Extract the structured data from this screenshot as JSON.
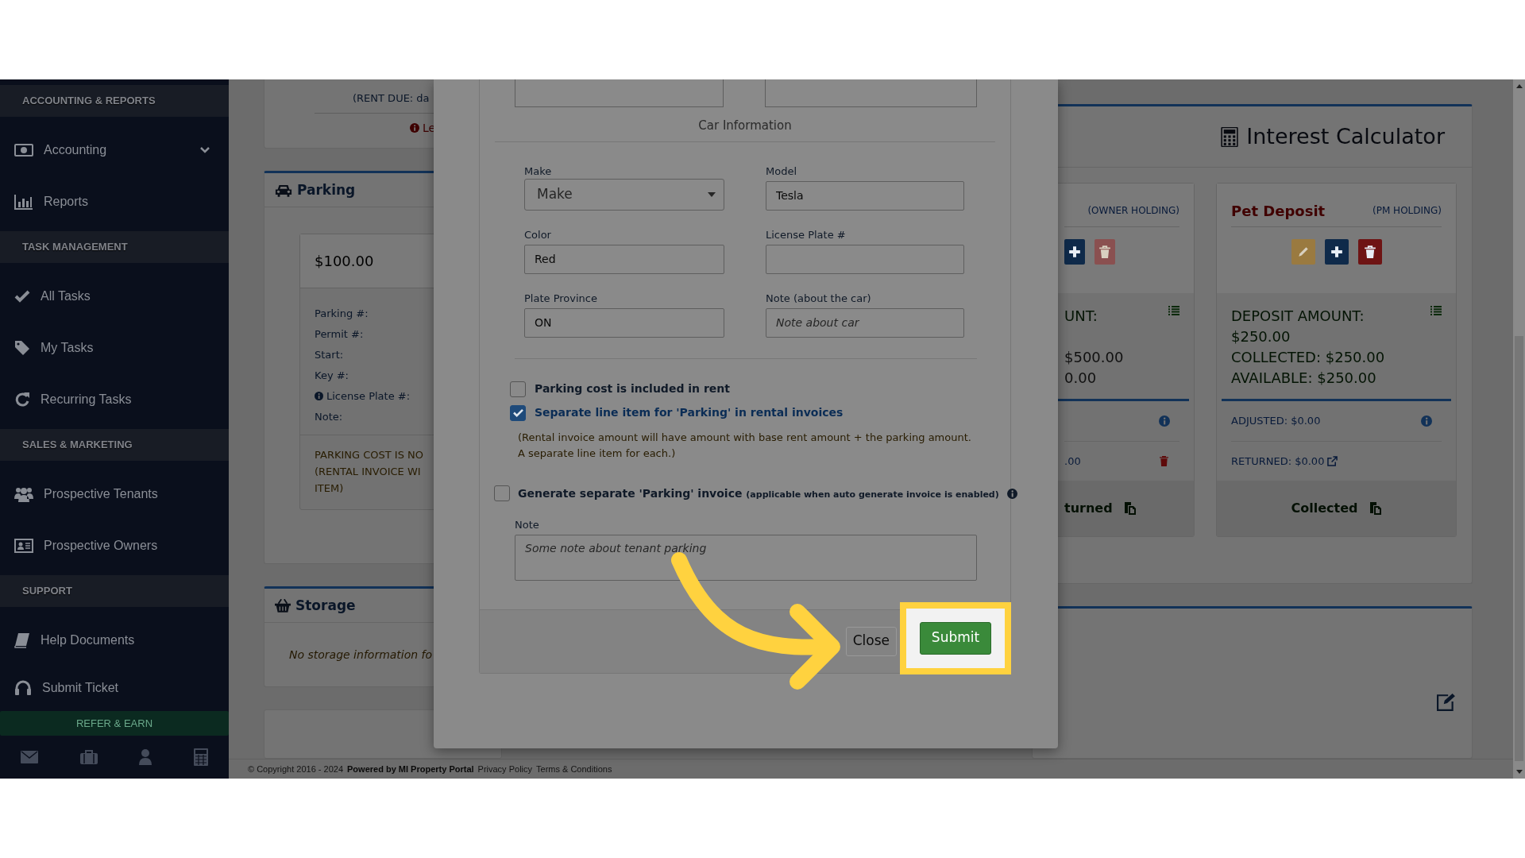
{
  "sidebar": {
    "sections": [
      {
        "title": "ACCOUNTING & REPORTS",
        "items": [
          {
            "label": "Accounting",
            "kind": "dropdown"
          },
          {
            "label": "Reports",
            "kind": "link"
          }
        ]
      },
      {
        "title": "TASK MANAGEMENT",
        "items": [
          {
            "label": "All Tasks",
            "kind": "link"
          },
          {
            "label": "My Tasks",
            "kind": "link"
          },
          {
            "label": "Recurring Tasks",
            "kind": "link"
          }
        ]
      },
      {
        "title": "SALES & MARKETING",
        "items": [
          {
            "label": "Prospective Tenants",
            "kind": "link"
          },
          {
            "label": "Prospective Owners",
            "kind": "link"
          }
        ]
      },
      {
        "title": "SUPPORT",
        "items": [
          {
            "label": "Help Documents",
            "kind": "link"
          },
          {
            "label": "Submit Ticket",
            "kind": "link"
          }
        ]
      }
    ],
    "refer_button": "REFER & EARN"
  },
  "page": {
    "rent_due": "(RENT DUE: da",
    "alert": "Le",
    "parking": {
      "title": "Parking",
      "amount": "$100.00",
      "fields": [
        {
          "label": "Parking #:",
          "kind": "plain"
        },
        {
          "label": "Permit #:",
          "kind": "plain"
        },
        {
          "label": "Start:",
          "kind": "plain"
        },
        {
          "label": "Key #:",
          "kind": "plain"
        },
        {
          "label": "License Plate #:",
          "kind": "info"
        },
        {
          "label": "Note:",
          "kind": "plain"
        }
      ],
      "notice": [
        "PARKING COST IS NO",
        "(RENTAL INVOICE WI",
        "ITEM)"
      ]
    },
    "storage": {
      "title": "Storage",
      "empty": "No storage information fo"
    },
    "interest_calculator": "Interest Calculator",
    "deposits": [
      {
        "holding": "(OWNER HOLDING)",
        "actions": [
          {
            "kind": "add",
            "disabled": false
          },
          {
            "kind": "delete",
            "disabled": true
          }
        ],
        "amount": "UNT:",
        "lines": [
          "$500.00",
          "0.00"
        ],
        "returned": {
          "text": ".00",
          "kind": "delete"
        },
        "status": "turned"
      },
      {
        "name": "Pet Deposit",
        "holding": "(PM HOLDING)",
        "actions": [
          {
            "kind": "edit",
            "disabled": true
          },
          {
            "kind": "add",
            "disabled": false
          },
          {
            "kind": "delete",
            "disabled": false
          }
        ],
        "amount": "DEPOSIT AMOUNT: $250.00",
        "lines": [
          "COLLECTED: $250.00",
          "AVAILABLE: $250.00"
        ],
        "adjusted": "ADJUSTED: $0.00",
        "returned": {
          "text": "RETURNED: $0.00",
          "kind": "link"
        },
        "status": "Collected"
      }
    ]
  },
  "footer": {
    "copyright": "© Copyright 2016 - 2024",
    "powered": "Powered by MI Property Portal",
    "links": [
      "Privacy Policy",
      "Terms & Conditions"
    ]
  },
  "modal": {
    "section_title": "Car Information",
    "fields": [
      {
        "label": "Make",
        "kind": "select",
        "placeholder": "Make"
      },
      {
        "label": "Model",
        "kind": "text",
        "value": "Tesla"
      },
      {
        "label": "Color",
        "kind": "text",
        "value": "Red"
      },
      {
        "label": "License Plate #",
        "kind": "text"
      },
      {
        "label": "Plate Province",
        "kind": "text",
        "value": "ON"
      },
      {
        "label": "Note (about the car)",
        "kind": "text",
        "placeholder": "Note about car"
      }
    ],
    "options": [
      {
        "label": "Parking cost is included in rent",
        "checked": false
      },
      {
        "label": "Separate line item for 'Parking' in rental invoices",
        "checked": true,
        "help": "(Rental invoice amount will have amount with base rent amount + the parking amount.\nA separate line item for each.)"
      }
    ],
    "invoice_option": {
      "label": "Generate separate 'Parking' invoice",
      "note": "(applicable when auto generate invoice is enabled)",
      "checked": false
    },
    "note": {
      "label": "Note",
      "placeholder": "Some note about tenant parking"
    },
    "buttons": [
      {
        "label": "Close",
        "kind": "secondary",
        "highlighted": false
      },
      {
        "label": "Submit",
        "kind": "primary",
        "highlighted": true
      }
    ]
  }
}
